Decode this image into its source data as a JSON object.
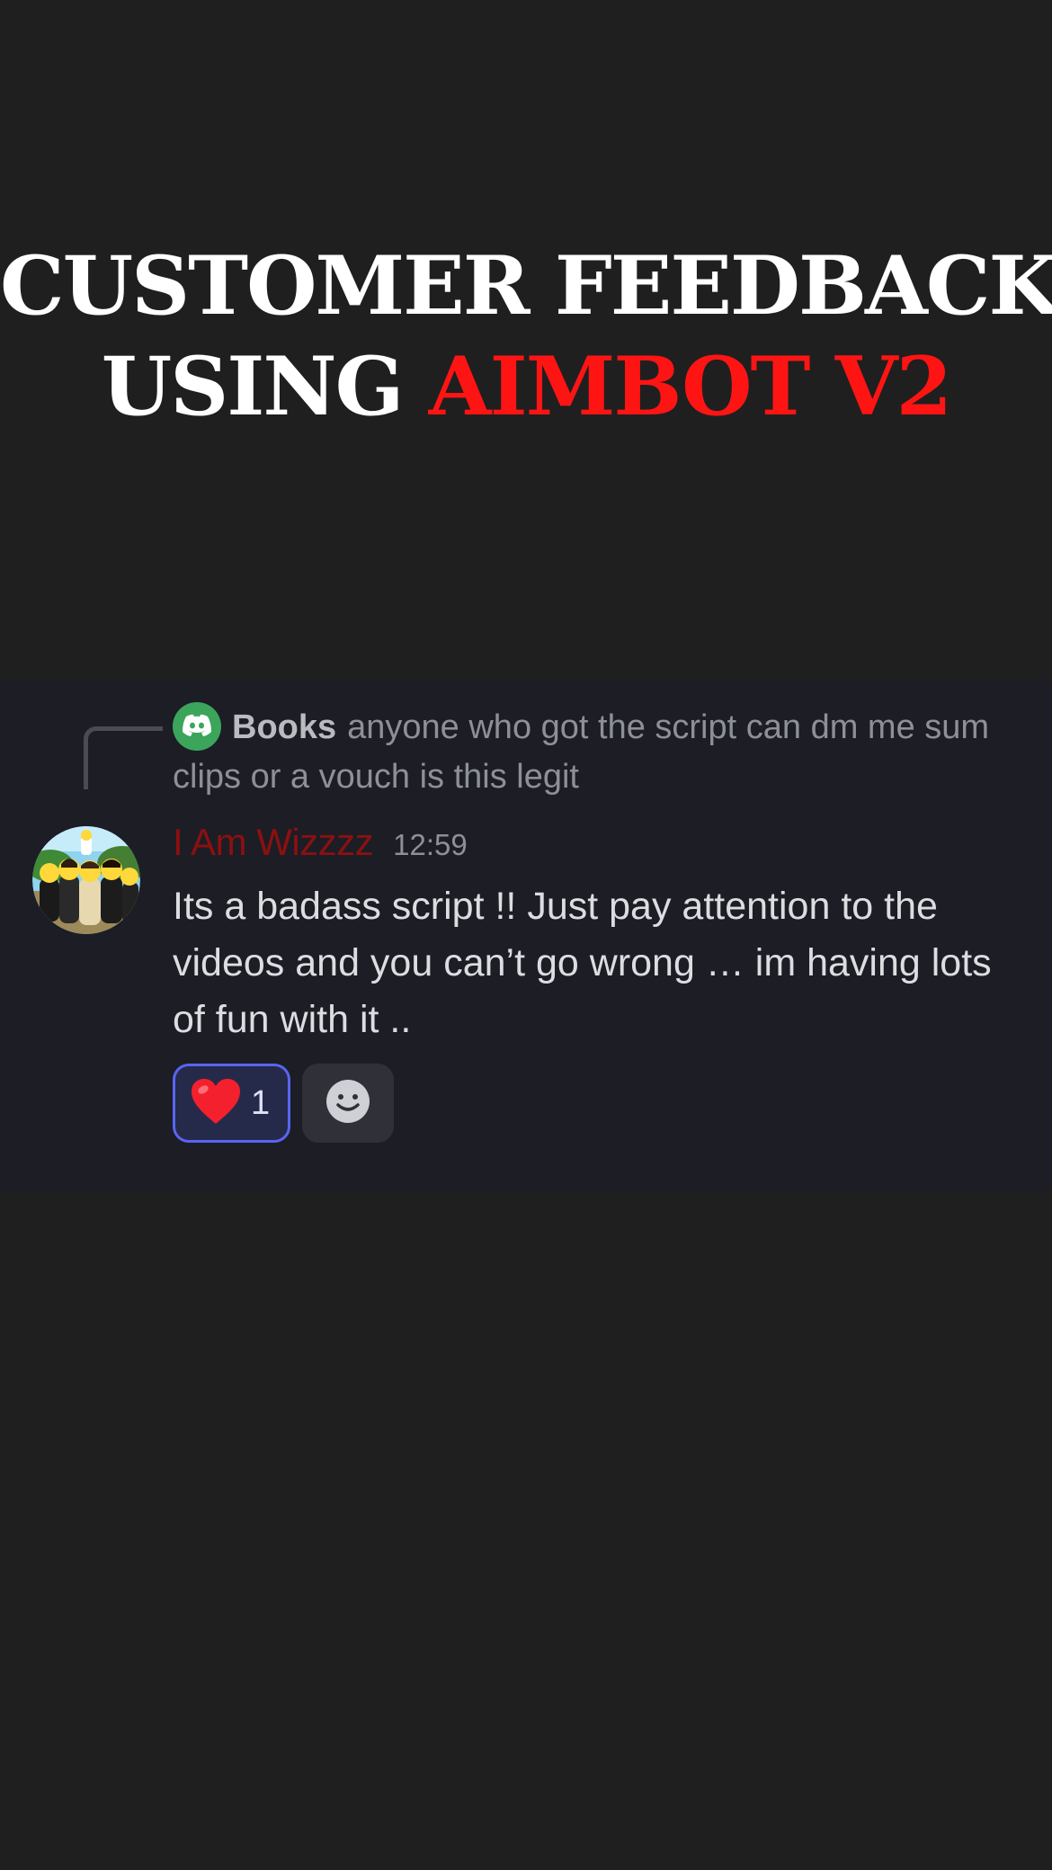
{
  "headline": {
    "line1": "CUSTOMER FEEDBACK",
    "line2_prefix": "USING",
    "line2_accent": "AIMBOT V2"
  },
  "colors": {
    "background": "#1f1f1f",
    "card": "#1c1d25",
    "accent_red": "#ff1414",
    "author_red": "#8c1010",
    "reaction_blurple": "#5865f2",
    "reply_avatar_green": "#3ba55c"
  },
  "reply": {
    "author": "Books",
    "text": "anyone who got the script can dm me sum clips or a vouch is this legit",
    "avatar_icon": "discord-logo-icon"
  },
  "message": {
    "author": "I Am Wizzzz",
    "timestamp": "12:59",
    "text": "Its a badass script !! Just pay attention to the videos and you can’t go wrong … im having lots of fun with it ..",
    "avatar_icon": "cartoon-group-avatar"
  },
  "reactions": [
    {
      "emoji": "❤️",
      "icon": "heart-icon",
      "count": "1"
    }
  ],
  "add_reaction": {
    "icon": "smiley-icon"
  }
}
